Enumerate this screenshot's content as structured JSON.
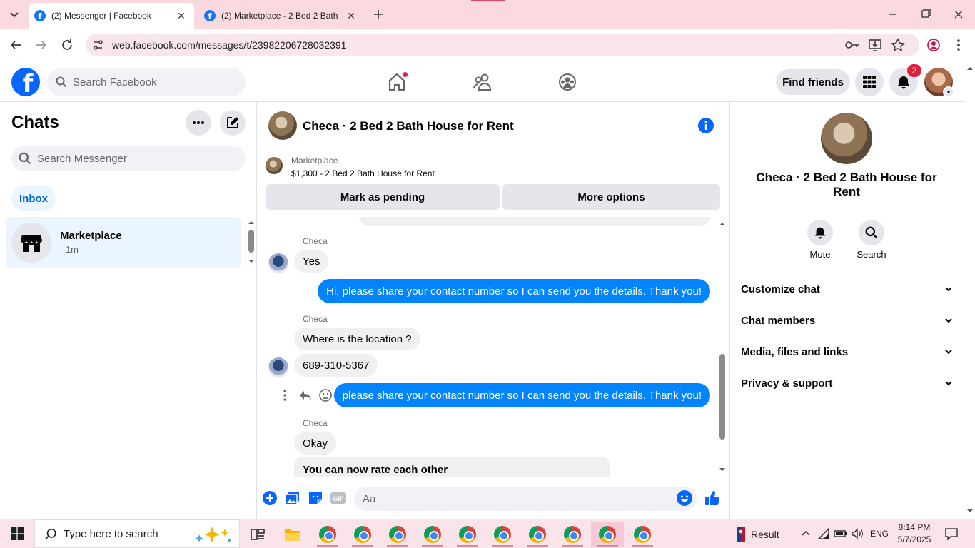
{
  "browser": {
    "tabs": [
      {
        "label": "(2) Messenger | Facebook",
        "active": true
      },
      {
        "label": "(2) Marketplace - 2 Bed 2 Bath",
        "active": false
      }
    ],
    "url": "web.facebook.com/messages/t/23982206728032391"
  },
  "fb_header": {
    "logo": "f",
    "search_placeholder": "Search Facebook",
    "find_friends_label": "Find friends",
    "notification_count": "2"
  },
  "sidebar": {
    "title": "Chats",
    "search_placeholder": "Search Messenger",
    "inbox_label": "Inbox",
    "chats": [
      {
        "name": "Marketplace",
        "time": "· 1m"
      }
    ]
  },
  "chat": {
    "title": "Checa · 2 Bed 2 Bath House for Rent",
    "marketplace_label": "Marketplace",
    "listing": "$1,300 - 2 Bed 2 Bath House for Rent",
    "pending_label": "Mark as pending",
    "more_options_label": "More options",
    "composer_placeholder": "Aa",
    "messages": [
      {
        "sender": "Checa",
        "text": "Yes",
        "direction": "in"
      },
      {
        "text": "Hi, please share your contact number so I can send you the details. Thank you!",
        "direction": "out"
      },
      {
        "sender": "Checa",
        "text": "Where is the location ?",
        "direction": "in"
      },
      {
        "text": "689-310-5367",
        "direction": "in"
      },
      {
        "text": "please share your contact number so I can send you the details. Thank you!",
        "direction": "out"
      },
      {
        "sender": "Checa",
        "text": "Okay",
        "direction": "in"
      },
      {
        "text": "You can now rate each other",
        "direction": "system"
      }
    ]
  },
  "details_panel": {
    "title": "Checa · 2 Bed 2 Bath House for Rent",
    "mute_label": "Mute",
    "search_label": "Search",
    "sections": [
      "Customize chat",
      "Chat members",
      "Media, files and links",
      "Privacy & support"
    ]
  },
  "taskbar": {
    "search_placeholder": "Type here to search",
    "result_label": "Result",
    "language": "ENG",
    "time": "8:14 PM",
    "date": "5/7/2025"
  },
  "colors": {
    "fb_blue": "#0866ff",
    "bubble_out": "#0084ff",
    "bubble_in": "#f0f0f0",
    "notif_red": "#e41e3f",
    "tabstrip": "#fbd9e1"
  }
}
